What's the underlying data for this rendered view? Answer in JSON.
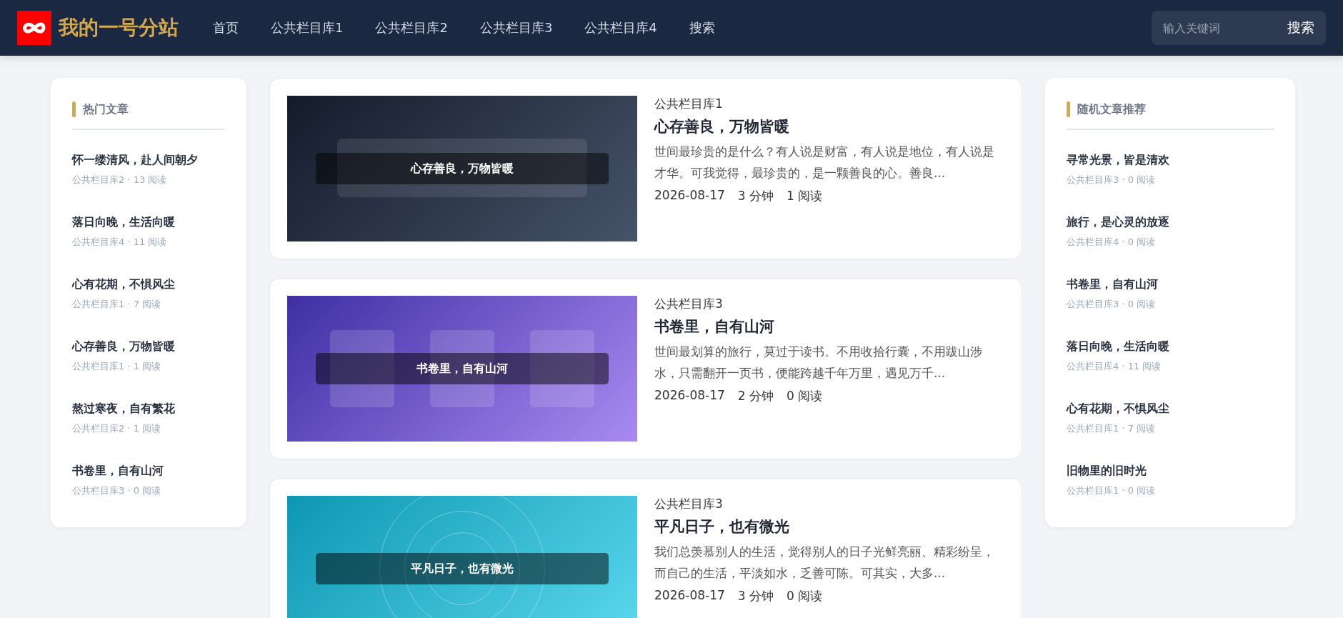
{
  "header": {
    "logo_text": "我的一号分站",
    "nav": [
      {
        "label": "首页"
      },
      {
        "label": "公共栏目库1"
      },
      {
        "label": "公共栏目库2"
      },
      {
        "label": "公共栏目库3"
      },
      {
        "label": "公共栏目库4"
      },
      {
        "label": "搜索"
      }
    ],
    "search": {
      "placeholder": "输入关键词",
      "button": "搜索"
    }
  },
  "hot": {
    "title": "热门文章",
    "items": [
      {
        "title": "怀一缕清风，赴人间朝夕",
        "meta": "公共栏目库2 · 13 阅读"
      },
      {
        "title": "落日向晚，生活向暖",
        "meta": "公共栏目库4 · 11 阅读"
      },
      {
        "title": "心有花期，不惧风尘",
        "meta": "公共栏目库1 · 7 阅读"
      },
      {
        "title": "心存善良，万物皆暖",
        "meta": "公共栏目库1 · 1 阅读"
      },
      {
        "title": "熬过寒夜，自有繁花",
        "meta": "公共栏目库2 · 1 阅读"
      },
      {
        "title": "书卷里，自有山河",
        "meta": "公共栏目库3 · 0 阅读"
      }
    ]
  },
  "articles": [
    {
      "cover": {
        "kind": "frame",
        "text": "心存善良，万物皆暖"
      },
      "category": "公共栏目库1",
      "title": "心存善良，万物皆暖",
      "excerpt": "世间最珍贵的是什么？有人说是财富，有人说是地位，有人说是才华。可我觉得，最珍贵的，是一颗善良的心。善良...",
      "date": "2026-08-17",
      "read_time": "3 分钟",
      "views": "1 阅读"
    },
    {
      "cover": {
        "kind": "tiles",
        "text": "书卷里，自有山河"
      },
      "category": "公共栏目库3",
      "title": "书卷里，自有山河",
      "excerpt": "世间最划算的旅行，莫过于读书。不用收拾行囊，不用跋山涉水，只需翻开一页书，便能跨越千年万里，遇见万千...",
      "date": "2026-08-17",
      "read_time": "2 分钟",
      "views": "0 阅读"
    },
    {
      "cover": {
        "kind": "rings",
        "text": "平凡日子，也有微光"
      },
      "category": "公共栏目库3",
      "title": "平凡日子，也有微光",
      "excerpt": "我们总羡慕别人的生活，觉得别人的日子光鲜亮丽、精彩纷呈，而自己的生活，平淡如水，乏善可陈。可其实，大多...",
      "date": "2026-08-17",
      "read_time": "3 分钟",
      "views": "0 阅读"
    }
  ],
  "random": {
    "title": "随机文章推荐",
    "items": [
      {
        "title": "寻常光景，皆是清欢",
        "meta": "公共栏目库3 · 0 阅读"
      },
      {
        "title": "旅行，是心灵的放逐",
        "meta": "公共栏目库4 · 0 阅读"
      },
      {
        "title": "书卷里，自有山河",
        "meta": "公共栏目库3 · 0 阅读"
      },
      {
        "title": "落日向晚，生活向暖",
        "meta": "公共栏目库4 · 11 阅读"
      },
      {
        "title": "心有花期，不惧风尘",
        "meta": "公共栏目库1 · 7 阅读"
      },
      {
        "title": "旧物里的旧时光",
        "meta": "公共栏目库1 · 0 阅读"
      }
    ]
  }
}
